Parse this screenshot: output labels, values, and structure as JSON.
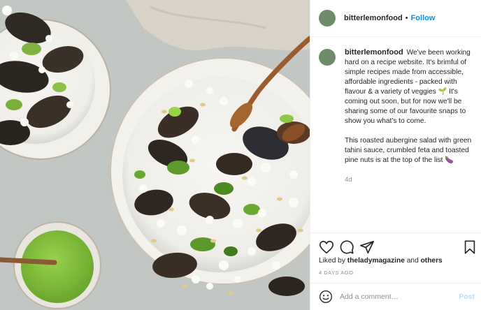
{
  "post": {
    "photo_subject": "roasted aubergine salad with green tahini sauce, feta and pine nuts"
  },
  "header": {
    "username": "bitterlemonfood",
    "separator": "•",
    "follow_label": "Follow"
  },
  "caption": {
    "username": "bitterlemonfood",
    "paragraph1": "We've been working hard on a recipe website. It's brimful of simple recipes made from accessible, affordable ingredients - packed with flavour & a variety of veggies 🌱 It's coming out soon, but for now we'll be sharing some of our favourite snaps to show you what's to come.",
    "paragraph2": "This roasted aubergine salad with green tahini sauce, crumbled feta and toasted pine nuts is at the top of the list 🍆",
    "time": "4d"
  },
  "actions": {
    "icons": [
      "heart-icon",
      "comment-icon",
      "share-icon",
      "bookmark-icon"
    ]
  },
  "likes": {
    "prefix": "Liked by",
    "user": "theladymagazine",
    "conjunction": "and",
    "others": "others"
  },
  "date": "4 DAYS AGO",
  "comment": {
    "placeholder": "Add a comment…",
    "post_label": "Post"
  },
  "colors": {
    "link_blue": "#0095f6",
    "post_disabled": "#b2dffc",
    "avatar": "#6f8c6a",
    "muted": "#8e8e8e"
  }
}
